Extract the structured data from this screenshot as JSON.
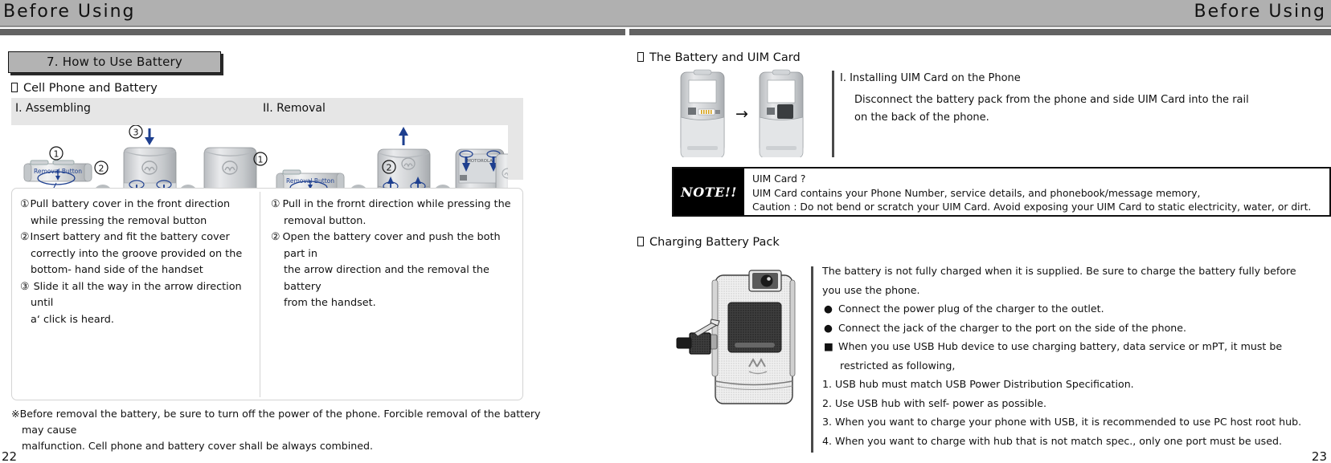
{
  "header": {
    "left_title": "Before Using",
    "right_title": "Before Using"
  },
  "left_page": {
    "chapter_title": "7. How to Use Battery",
    "section_title": "Cell Phone and Battery",
    "figure_labels": {
      "assembling": "I. Assembling",
      "removal": "II. Removal"
    },
    "figure_callouts": {
      "removal_button": "Removal Button",
      "marks": [
        "①",
        "②",
        "③"
      ]
    },
    "assembling_steps": [
      {
        "num": "①",
        "lines": [
          "Pull battery cover in the front direction",
          "while pressing the removal button"
        ]
      },
      {
        "num": "②",
        "lines": [
          "Insert battery and fit the battery cover",
          "correctly into the groove provided on the",
          "bottom- hand side of the handset"
        ]
      },
      {
        "num": "③",
        "lines": [
          "Slide it all the way in the arrow direction until",
          "a‘ click  is heard."
        ]
      }
    ],
    "removal_steps": [
      {
        "num": "①",
        "lines": [
          "Pull in the frornt direction while pressing the",
          "removal button."
        ]
      },
      {
        "num": "②",
        "lines": [
          "Open the battery cover and push the both part in",
          "the arrow direction and the removal the battery",
          "from the handset."
        ]
      }
    ],
    "footnote": {
      "mark": "※",
      "lines": [
        "Before removal the battery, be sure to turn off the power of the phone. Forcible removal of the battery may cause",
        "malfunction. Cell phone and battery cover shall be always combined."
      ]
    },
    "page_number": "22"
  },
  "right_page": {
    "section_title_battery_uim": "The Battery and UIM Card",
    "uim": {
      "heading": "I. Installing UIM Card on the Phone",
      "body_lines": [
        "Disconnect the battery pack from the phone and side UIM Card into the rail",
        "on the back of the phone."
      ],
      "arrow": "→"
    },
    "note": {
      "badge": "NOTE!!",
      "lines": [
        "UIM Card ?",
        "UIM Card contains your Phone Number, service details, and phonebook/message memory,",
        "Caution : Do not bend or scratch your UIM Card. Avoid exposing your UIM Card to static electricity, water, or dirt."
      ]
    },
    "section_title_charging": "Charging Battery Pack",
    "charging": {
      "intro_lines": [
        "The battery is not fully charged when it is supplied. Be sure to charge the battery fully before",
        "you use the phone."
      ],
      "bullets": [
        {
          "mark": "●",
          "text": "Connect the power plug of the charger to the outlet."
        },
        {
          "mark": "●",
          "text": "Connect the jack of the charger to the port on the side of the phone."
        },
        {
          "mark": "■",
          "text": "When you use USB Hub device to use charging battery, data service or mPT, it must be"
        }
      ],
      "bullet_continuation": "restricted as following,",
      "numbered": [
        "1. USB hub must match USB Power Distribution Specification.",
        "2. Use USB hub with self- power as possible.",
        "3. When you want to charge your phone with USB, it is recommended to use PC host root hub.",
        "4. When you want to charge with hub that is not match spec., only one port must be used."
      ]
    },
    "page_number": "23"
  },
  "colors": {
    "header_band": "#b0b0b0",
    "header_rule_dark": "#636363",
    "chapter_box_fill": "#b3b3b3",
    "figure_panel": "#e6e6e6",
    "note_badge": "#000000",
    "callout_blue": "#1e3f8f"
  }
}
